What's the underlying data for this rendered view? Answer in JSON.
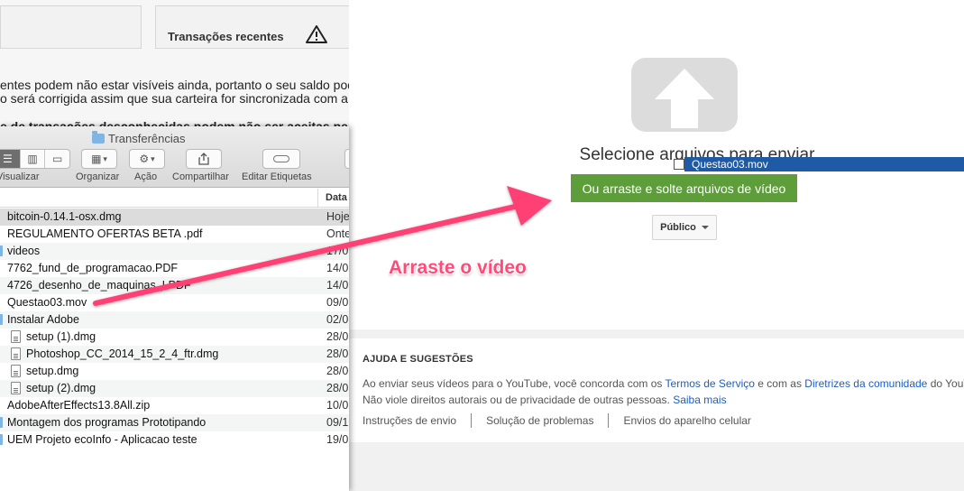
{
  "wallet": {
    "recent_title": "Transações recentes",
    "warning_icon": "warning-triangle-icon",
    "line1": "entes podem não estar visíveis ainda, portanto o seu saldo pod",
    "line2": "o será corrigida assim que sua carteira for sincronizada com a r",
    "line3": "e de transações desconhecidas podem não ser aceitas pela"
  },
  "finder": {
    "title": "Transferências",
    "toolbar": {
      "visualizar": "Visualizar",
      "organizar": "Organizar",
      "acao": "Ação",
      "compartilhar": "Compartilhar",
      "editar_etiquetas": "Editar Etiquetas"
    },
    "columns": {
      "date": "Data"
    },
    "files": [
      {
        "name": "bitcoin-0.14.1-osx.dmg",
        "date": "Hoje"
      },
      {
        "name": "REGULAMENTO OFERTAS BETA .pdf",
        "date": "Onte"
      },
      {
        "name": "videos",
        "date": "17/0"
      },
      {
        "name": "7762_fund_de_programacao.PDF",
        "date": "14/0"
      },
      {
        "name": "4726_desenho_de_maquinas_I.PDF",
        "date": "14/0"
      },
      {
        "name": "Questao03.mov",
        "date": "09/0"
      },
      {
        "name": "Instalar Adobe",
        "date": "02/0"
      },
      {
        "name": "setup (1).dmg",
        "date": "28/0"
      },
      {
        "name": "Photoshop_CC_2014_15_2_4_ftr.dmg",
        "date": "28/0"
      },
      {
        "name": "setup.dmg",
        "date": "28/0"
      },
      {
        "name": "setup (2).dmg",
        "date": "28/0"
      },
      {
        "name": "AdobeAfterEffects13.8All.zip",
        "date": "10/0"
      },
      {
        "name": "Montagem dos programas Prototipando",
        "date": "09/1"
      },
      {
        "name": "UEM Projeto ecoInfo - Aplicacao teste",
        "date": "19/0"
      }
    ]
  },
  "youtube": {
    "upload_title": "Selecione arquivos para enviar",
    "drop_button": "Ou arraste e solte arquivos de vídeo",
    "privacy": "Público",
    "drag_file": "Questao03.mov",
    "help": {
      "title": "AJUDA E SUGESTÕES",
      "line1_a": "Ao enviar seus vídeos para o YouTube, você concorda com os ",
      "terms_link": "Termos de Serviço",
      "line1_b": " e com as ",
      "guidelines_link": "Diretrizes da comunidade",
      "line1_c": " do YouT",
      "line2_a": "Não viole direitos autorais ou de privacidade de outras pessoas. ",
      "learn_more": "Saiba mais",
      "nav": [
        "Instruções de envio",
        "Solução de problemas",
        "Envios do aparelho celular"
      ]
    }
  },
  "annotation": {
    "text": "Arraste o vídeo",
    "color": "#ff4b7a"
  }
}
